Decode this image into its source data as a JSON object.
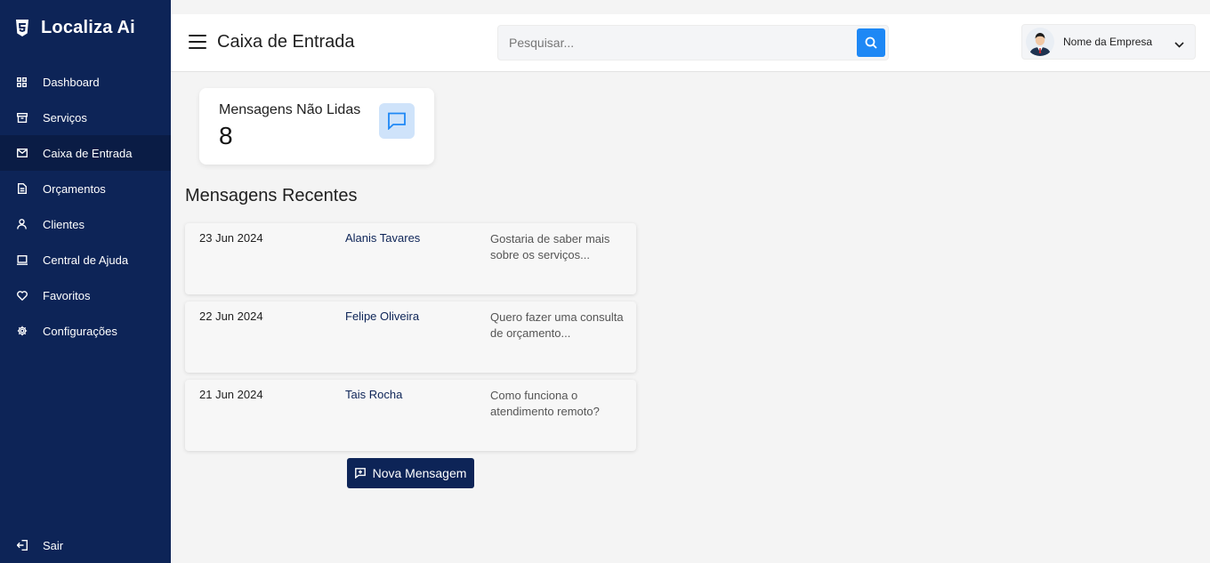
{
  "brand": {
    "name": "Localiza Ai",
    "icon": "html5-shield-icon"
  },
  "sidebar": {
    "items": [
      {
        "label": "Dashboard",
        "icon": "grid-icon",
        "active": false
      },
      {
        "label": "Serviços",
        "icon": "archive-icon",
        "active": false
      },
      {
        "label": "Caixa de Entrada",
        "icon": "mail-icon",
        "active": true
      },
      {
        "label": "Orçamentos",
        "icon": "document-icon",
        "active": false
      },
      {
        "label": "Clientes",
        "icon": "user-icon",
        "active": false
      },
      {
        "label": "Central de Ajuda",
        "icon": "laptop-icon",
        "active": false
      },
      {
        "label": "Favoritos",
        "icon": "heart-icon",
        "active": false
      },
      {
        "label": "Configurações",
        "icon": "gear-icon",
        "active": false
      }
    ],
    "logout_label": "Sair"
  },
  "header": {
    "title": "Caixa de Entrada",
    "search_placeholder": "Pesquisar...",
    "profile_name": "Nome da Empresa"
  },
  "stat": {
    "label": "Mensagens Não Lidas",
    "value": "8"
  },
  "recent": {
    "title": "Mensagens Recentes",
    "messages": [
      {
        "date": "23 Jun 2024",
        "from": "Alanis Tavares",
        "preview": "Gostaria de saber mais sobre os serviços..."
      },
      {
        "date": "22 Jun 2024",
        "from": "Felipe Oliveira",
        "preview": "Quero fazer uma consulta de orçamento..."
      },
      {
        "date": "21 Jun 2024",
        "from": "Tais Rocha",
        "preview": "Como funciona o atendimento remoto?"
      }
    ]
  },
  "actions": {
    "new_message_label": "Nova Mensagem"
  },
  "colors": {
    "sidebar_bg": "#0d2457",
    "sidebar_active": "#0a1c45",
    "accent": "#1e88f5",
    "stat_icon_bg": "#cfe3fa",
    "background": "#f4f4f4"
  }
}
